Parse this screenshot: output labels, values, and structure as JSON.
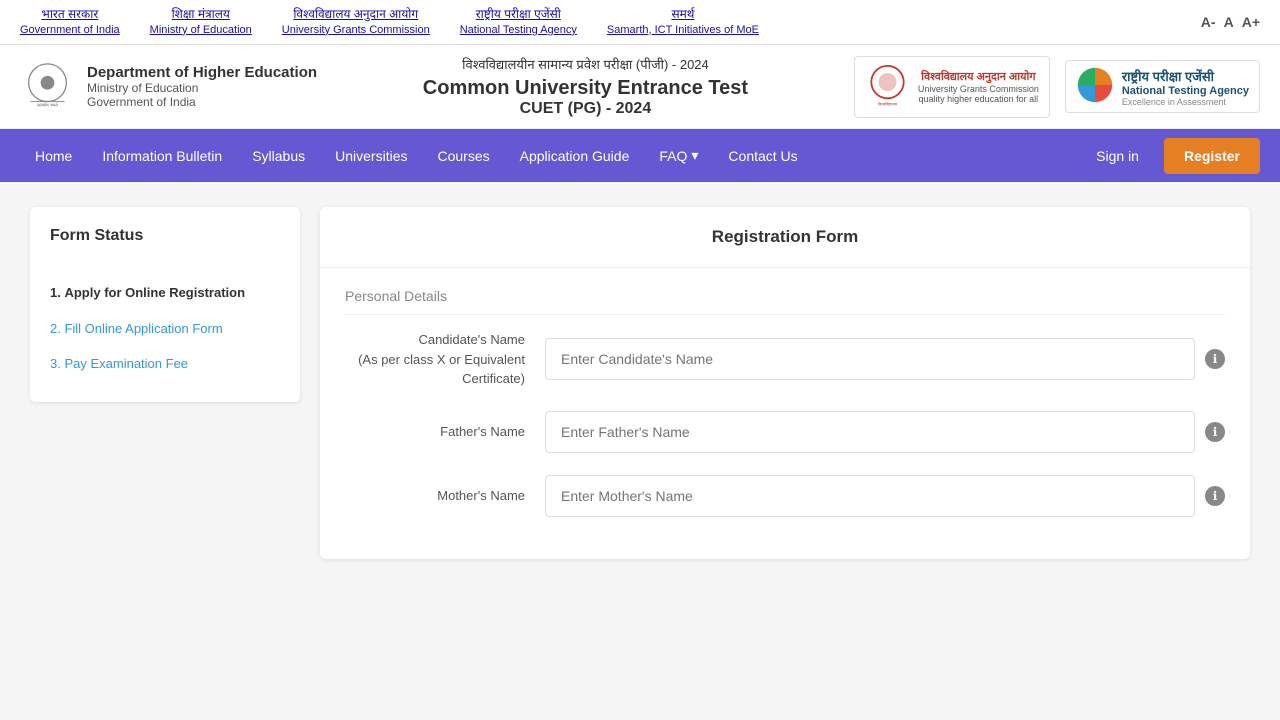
{
  "topbar": {
    "links": [
      {
        "id": "govt-india",
        "hindi": "भारत सरकार",
        "english": "Government of India",
        "url": "#"
      },
      {
        "id": "moe",
        "hindi": "शिक्षा मंत्रालय",
        "english": "Ministry of Education",
        "url": "#"
      },
      {
        "id": "ugc",
        "hindi": "विश्वविद्यालय अनुदान आयोग",
        "english": "University Grants Commission",
        "url": "#"
      },
      {
        "id": "nta",
        "hindi": "राष्ट्रीय परीक्षा एजेंसी",
        "english": "National Testing Agency",
        "url": "#"
      },
      {
        "id": "samarth",
        "hindi": "समर्थ",
        "english": "Samarth, ICT Initiatives of MoE",
        "url": "#"
      }
    ],
    "font_controls": {
      "small": "A-",
      "normal": "A",
      "large": "A+"
    }
  },
  "header": {
    "dept_name": "Department of Higher Education",
    "ministry": "Ministry of Education",
    "govt": "Government of India",
    "hindi_title": "विश्वविद्यालयीन सामान्य प्रवेश परीक्षा (पीजी) - 2024",
    "main_title": "Common University Entrance Test",
    "sub_title": "CUET (PG) - 2024",
    "ugc": {
      "name": "विश्वविद्यालय अनुदान आयोग",
      "english": "University Grants Commission",
      "tagline": "quality higher education for all"
    },
    "nta": {
      "name": "राष्ट्रीय  परीक्षा  एजेंसी",
      "english": "National Testing Agency",
      "tagline": "Excellence in Assessment"
    }
  },
  "navbar": {
    "items": [
      {
        "id": "home",
        "label": "Home"
      },
      {
        "id": "info-bulletin",
        "label": "Information Bulletin"
      },
      {
        "id": "syllabus",
        "label": "Syllabus"
      },
      {
        "id": "universities",
        "label": "Universities"
      },
      {
        "id": "courses",
        "label": "Courses"
      },
      {
        "id": "app-guide",
        "label": "Application Guide"
      },
      {
        "id": "faq",
        "label": "FAQ",
        "has_dropdown": true
      },
      {
        "id": "contact-us",
        "label": "Contact Us"
      }
    ],
    "signin": "Sign in",
    "register": "Register"
  },
  "form_status": {
    "title": "Form Status",
    "steps": [
      {
        "id": "step1",
        "label": "Apply for Online Registration",
        "active": true,
        "number": "1."
      },
      {
        "id": "step2",
        "label": "Fill Online Application Form",
        "active": false,
        "number": "2."
      },
      {
        "id": "step3",
        "label": "Pay Examination Fee",
        "active": false,
        "number": "3."
      }
    ]
  },
  "registration_form": {
    "title": "Registration Form",
    "section": "Personal Details",
    "fields": [
      {
        "id": "candidate-name",
        "label": "Candidate's Name",
        "sublabel": "(As per class X or Equivalent Certificate)",
        "placeholder": "Enter Candidate's Name",
        "has_info": true
      },
      {
        "id": "father-name",
        "label": "Father's Name",
        "sublabel": "",
        "placeholder": "Enter Father's Name",
        "has_info": true
      },
      {
        "id": "mother-name",
        "label": "Mother's Name",
        "sublabel": "",
        "placeholder": "Enter Mother's Name",
        "has_info": true
      }
    ]
  }
}
